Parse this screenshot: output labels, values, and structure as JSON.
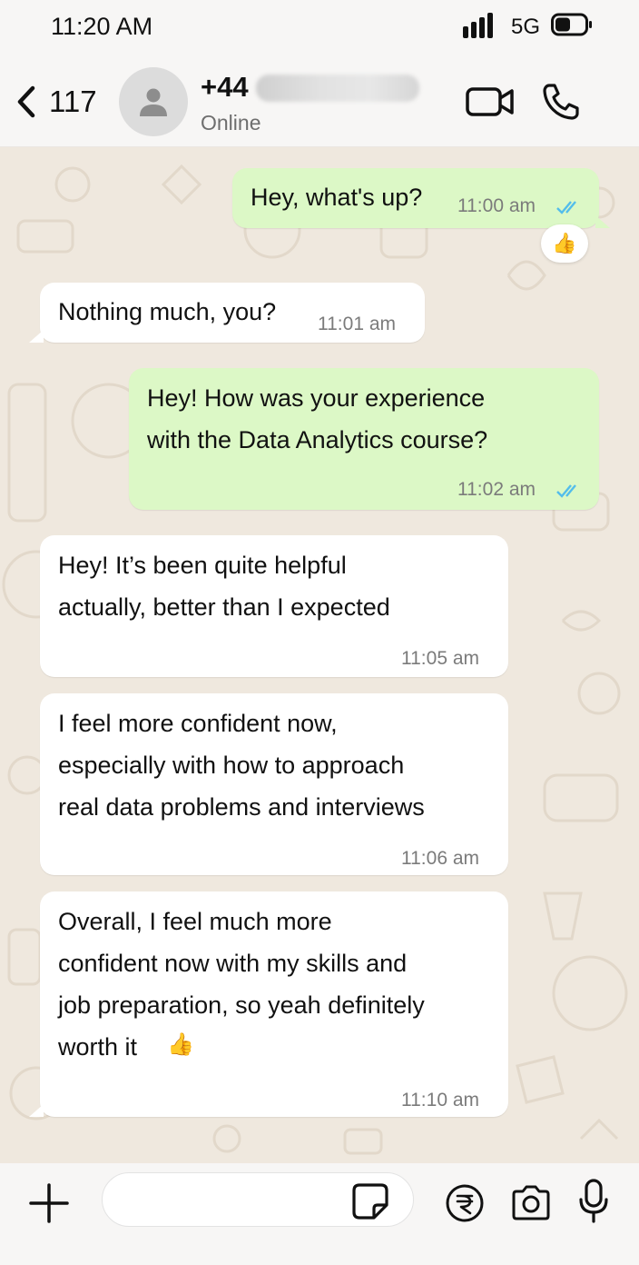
{
  "status_bar": {
    "time": "11:20 AM",
    "network": "5G",
    "icons": [
      "signal-icon",
      "battery-icon"
    ]
  },
  "header": {
    "unread_count": "117",
    "contact_name": "+44",
    "contact_status": "Online",
    "icons": [
      "back-chevron-icon",
      "avatar-person-icon",
      "video-call-icon",
      "phone-call-icon"
    ]
  },
  "messages": [
    {
      "direction": "out",
      "text": "Hey, what's up?",
      "time": "11:00 am",
      "read": true,
      "reaction": "👍"
    },
    {
      "direction": "in",
      "text": "Nothing much, you?",
      "time": "11:01 am"
    },
    {
      "direction": "out",
      "text": "Hey! How was your experience\nwith the Data Analytics course?",
      "time": "11:02 am",
      "read": true
    },
    {
      "direction": "in",
      "text": "Hey! It’s been quite helpful\nactually, better than I expected",
      "time": "11:05 am"
    },
    {
      "direction": "in",
      "text": "I feel more confident now,\nespecially with how to approach\nreal data problems and interviews",
      "time": "11:06 am"
    },
    {
      "direction": "in",
      "text": "Overall, I feel much more\nconfident now with my skills and\njob preparation, so yeah definitely\nworth it",
      "emoji": "👍",
      "time": "11:10 am"
    }
  ],
  "input_bar": {
    "placeholder": "",
    "value": "",
    "icons": [
      "plus-icon",
      "sticker-icon",
      "rupee-payment-icon",
      "camera-icon",
      "microphone-icon"
    ]
  },
  "colors": {
    "outgoing_bubble": "#dcf8c6",
    "incoming_bubble": "#ffffff",
    "chat_background": "#efe8de",
    "read_ticks": "#53bdeb"
  }
}
